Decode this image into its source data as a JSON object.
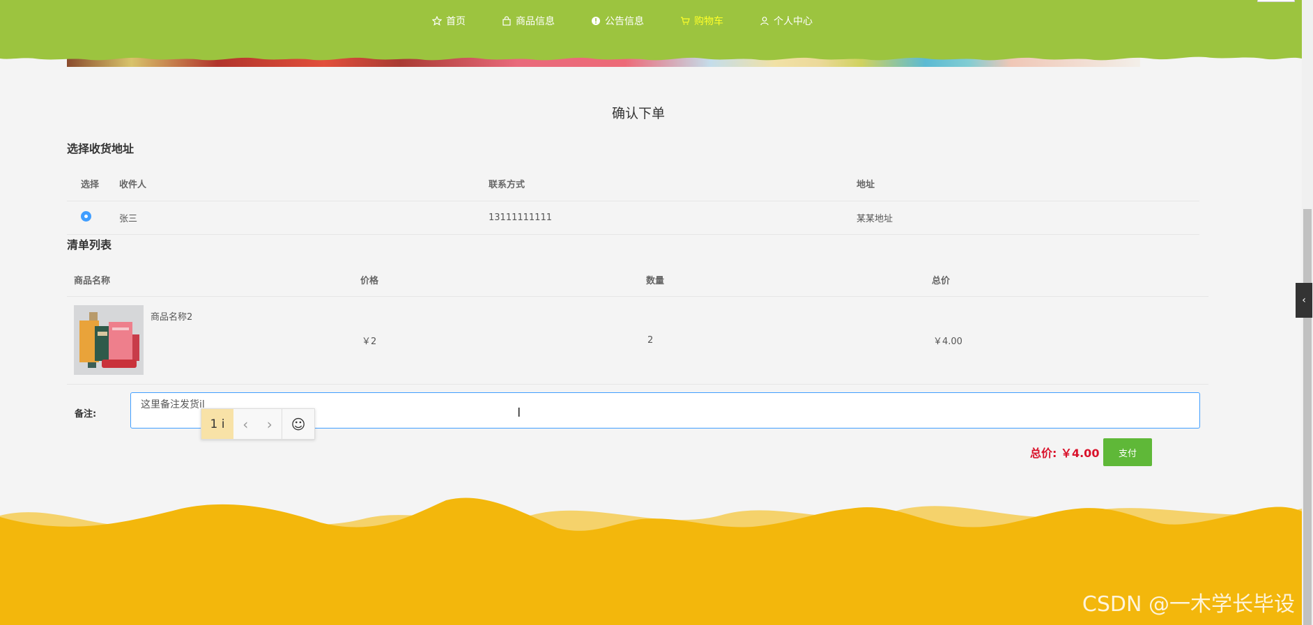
{
  "nav": {
    "items": [
      {
        "label": "首页",
        "icon": "star-icon",
        "active": false
      },
      {
        "label": "商品信息",
        "icon": "bag-icon",
        "active": false
      },
      {
        "label": "公告信息",
        "icon": "info-icon",
        "active": false
      },
      {
        "label": "购物车",
        "icon": "cart-icon",
        "active": true
      },
      {
        "label": "个人中心",
        "icon": "user-icon",
        "active": false
      }
    ],
    "bar_color": "#9cc43f",
    "active_color": "#ffff29"
  },
  "page": {
    "title": "确认下单"
  },
  "address": {
    "section_title": "选择收货地址",
    "headers": {
      "select": "选择",
      "receiver": "收件人",
      "phone": "联系方式",
      "address": "地址"
    },
    "rows": [
      {
        "selected": true,
        "receiver": "张三",
        "phone": "13111111111",
        "address": "某某地址"
      }
    ]
  },
  "order": {
    "section_title": "清单列表",
    "headers": {
      "name": "商品名称",
      "price": "价格",
      "qty": "数量",
      "total": "总价"
    },
    "items": [
      {
        "name": "商品名称2",
        "price": "￥2",
        "qty": "2",
        "total": "￥4.00"
      }
    ]
  },
  "remark": {
    "label": "备注:",
    "value": "这里备注发货il"
  },
  "ime": {
    "candidate": "1 i"
  },
  "summary": {
    "total_label": "总价: ￥4.00",
    "pay_label": "支付"
  },
  "watermark": "CSDN @一木学长毕设",
  "colors": {
    "accent": "#409eff",
    "pay": "#5fb838",
    "total": "#d9122b",
    "footer": "#f3b70c"
  }
}
